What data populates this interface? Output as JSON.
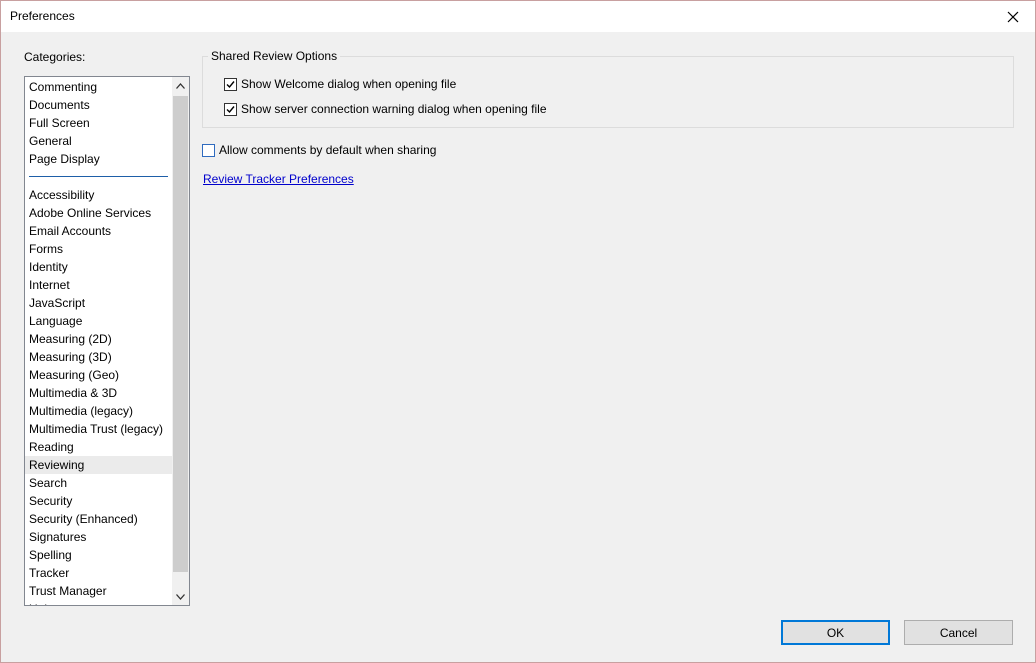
{
  "window": {
    "title": "Preferences"
  },
  "categories": {
    "label": "Categories:",
    "group1": [
      "Commenting",
      "Documents",
      "Full Screen",
      "General",
      "Page Display"
    ],
    "group2": [
      "Accessibility",
      "Adobe Online Services",
      "Email Accounts",
      "Forms",
      "Identity",
      "Internet",
      "JavaScript",
      "Language",
      "Measuring (2D)",
      "Measuring (3D)",
      "Measuring (Geo)",
      "Multimedia & 3D",
      "Multimedia (legacy)",
      "Multimedia Trust (legacy)",
      "Reading",
      "Reviewing",
      "Search",
      "Security",
      "Security (Enhanced)",
      "Signatures",
      "Spelling",
      "Tracker",
      "Trust Manager",
      "Units"
    ],
    "selected": "Reviewing"
  },
  "shared_review": {
    "legend": "Shared Review Options",
    "show_welcome": {
      "label": "Show Welcome dialog when opening file",
      "checked": true
    },
    "show_server_warning": {
      "label": "Show server connection warning dialog when opening file",
      "checked": true
    }
  },
  "allow_comments": {
    "label": "Allow comments by default when sharing",
    "checked": false
  },
  "review_tracker_link": "Review Tracker Preferences",
  "buttons": {
    "ok": "OK",
    "cancel": "Cancel"
  }
}
